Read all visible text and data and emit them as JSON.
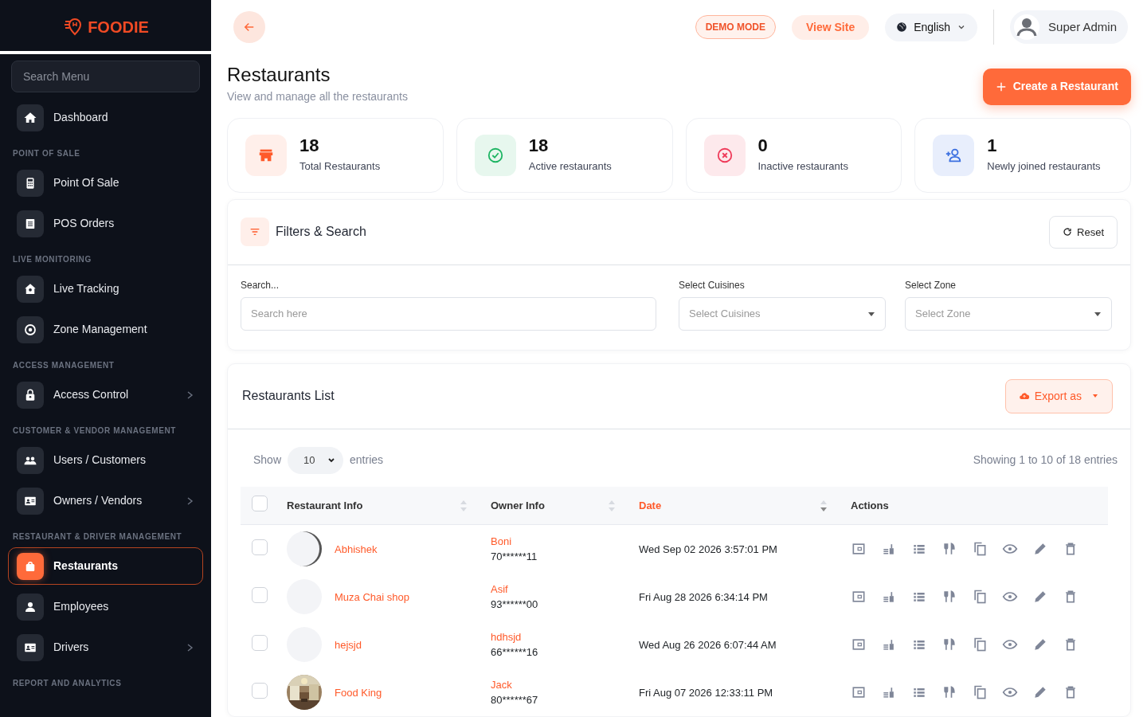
{
  "brand": {
    "name": "FOODIE"
  },
  "sidebar": {
    "search": {
      "placeholder": "Search Menu"
    },
    "groups": [
      {
        "items": [
          {
            "label": "Dashboard",
            "chevron": false,
            "selected": false
          }
        ]
      },
      {
        "heading": "POINT OF SALE",
        "items": [
          {
            "label": "Point Of Sale",
            "chevron": false,
            "selected": false
          },
          {
            "label": "POS Orders",
            "chevron": false,
            "selected": false
          }
        ]
      },
      {
        "heading": "LIVE MONITORING",
        "items": [
          {
            "label": "Live Tracking",
            "chevron": false,
            "selected": false
          },
          {
            "label": "Zone Management",
            "chevron": false,
            "selected": false
          }
        ]
      },
      {
        "heading": "ACCESS MANAGEMENT",
        "items": [
          {
            "label": "Access Control",
            "chevron": true,
            "selected": false
          }
        ]
      },
      {
        "heading": "CUSTOMER & VENDOR MANAGEMENT",
        "items": [
          {
            "label": "Users / Customers",
            "chevron": false,
            "selected": false
          },
          {
            "label": "Owners / Vendors",
            "chevron": true,
            "selected": false
          }
        ]
      },
      {
        "heading": "RESTAURANT & DRIVER MANAGEMENT",
        "items": [
          {
            "label": "Restaurants",
            "chevron": false,
            "selected": true
          },
          {
            "label": "Employees",
            "chevron": false,
            "selected": false
          },
          {
            "label": "Drivers",
            "chevron": true,
            "selected": false
          }
        ]
      },
      {
        "heading": "REPORT AND ANALYTICS"
      }
    ]
  },
  "topbar": {
    "demo_badge": "DEMO MODE",
    "view_site": "View Site",
    "language": "English",
    "user": "Super Admin"
  },
  "page": {
    "title": "Restaurants",
    "subtitle": "View and manage all the restaurants",
    "create_button": "Create a Restaurant"
  },
  "stats": [
    {
      "kind": "total",
      "value": "18",
      "label": "Total Restaurants"
    },
    {
      "kind": "active",
      "value": "18",
      "label": "Active restaurants"
    },
    {
      "kind": "inactive",
      "value": "0",
      "label": "Inactive restaurants"
    },
    {
      "kind": "new",
      "value": "1",
      "label": "Newly joined restaurants"
    }
  ],
  "filters": {
    "title": "Filters & Search",
    "reset": "Reset",
    "fields": [
      {
        "kind": "input",
        "label": "Search...",
        "placeholder": "Search here"
      },
      {
        "kind": "select",
        "label": "Select Cuisines",
        "placeholder": "Select Cuisines"
      },
      {
        "kind": "select",
        "label": "Select Zone",
        "placeholder": "Select Zone"
      }
    ]
  },
  "list": {
    "title": "Restaurants List",
    "export": "Export as",
    "show_label": "Show",
    "page_size": "10",
    "entries_label": "entries",
    "showing": "Showing 1 to 10 of 18 entries",
    "all_checked": false,
    "columns": [
      {
        "label": "Restaurant Info",
        "kind": "sortable",
        "sorted": false
      },
      {
        "label": "Owner Info",
        "kind": "sortable",
        "sorted": false
      },
      {
        "label": "Date",
        "kind": "sortable",
        "sorted": true
      },
      {
        "label": "Actions",
        "kind": "plain",
        "sorted": false
      }
    ],
    "rows": [
      {
        "kind": "clipped",
        "name": "Abhishek",
        "owner": "Boni",
        "phone": "70******11",
        "date": "Wed Sep 02 2026 3:57:01 PM",
        "checked": false
      },
      {
        "kind": "blank",
        "name": "Muza Chai shop",
        "owner": "Asif",
        "phone": "93******00",
        "date": "Fri Aug 28 2026 6:34:14 PM",
        "checked": false
      },
      {
        "kind": "blank",
        "name": "hejsjd",
        "owner": "hdhsjd",
        "phone": "66******16",
        "date": "Wed Aug 26 2026 6:07:44 AM",
        "checked": false
      },
      {
        "kind": "picture",
        "name": "Food King",
        "owner": "Jack",
        "phone": "80******67",
        "date": "Fri Aug 07 2026 12:33:11 PM",
        "checked": false
      }
    ]
  }
}
